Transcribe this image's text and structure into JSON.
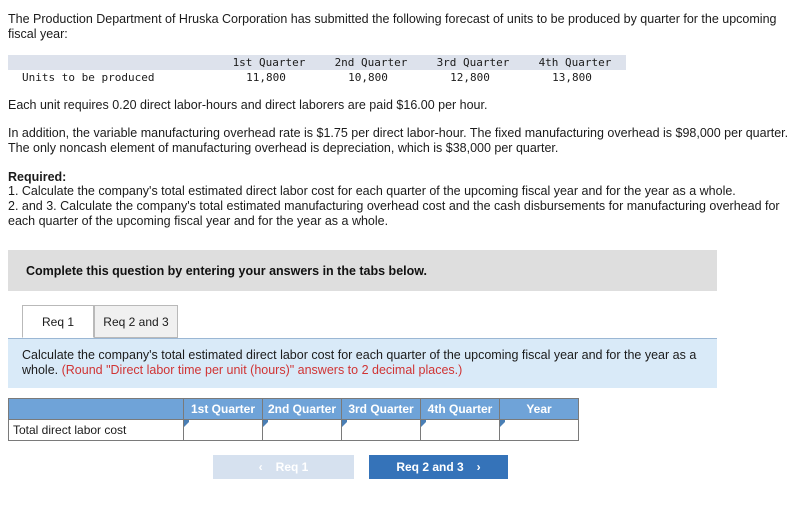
{
  "intro": {
    "paragraph": "The Production Department of Hruska Corporation has submitted the following forecast of units to be produced by quarter for the upcoming fiscal year:"
  },
  "forecast_table": {
    "row_label_header": "",
    "columns": [
      "1st Quarter",
      "2nd Quarter",
      "3rd Quarter",
      "4th Quarter"
    ],
    "rows": [
      {
        "label": "Units to be produced",
        "values": [
          "11,800",
          "10,800",
          "12,800",
          "13,800"
        ]
      }
    ]
  },
  "facts": {
    "labor": "Each unit requires 0.20 direct labor-hours and direct laborers are paid $16.00 per hour.",
    "overhead": "In addition, the variable manufacturing overhead rate is $1.75 per direct labor-hour. The fixed manufacturing overhead is $98,000 per quarter. The only noncash element of manufacturing overhead is depreciation, which is $38,000 per quarter."
  },
  "required": {
    "title": "Required:",
    "item1": "1. Calculate the company's total estimated direct labor cost for each quarter of the upcoming fiscal year and for the year as a whole.",
    "item2": "2. and 3. Calculate the company's total estimated manufacturing overhead cost and the cash disbursements for manufacturing overhead for each quarter of the upcoming fiscal year and for the year as a whole."
  },
  "banner": {
    "text": "Complete this question by entering your answers in the tabs below."
  },
  "tabs": [
    {
      "label": "Req 1",
      "active": true
    },
    {
      "label": "Req 2 and 3",
      "active": false
    }
  ],
  "instruction_panel": {
    "text_main": "Calculate the company's total estimated direct labor cost for each quarter of the upcoming fiscal year and for the year as a whole. ",
    "text_note": "(Round \"Direct labor time per unit (hours)\" answers to 2 decimal places.)"
  },
  "answer_table": {
    "blank_header": "",
    "columns": [
      "1st Quarter",
      "2nd Quarter",
      "3rd Quarter",
      "4th Quarter",
      "Year"
    ],
    "rows": [
      {
        "label": "Total direct labor cost",
        "values": [
          "",
          "",
          "",
          "",
          ""
        ]
      }
    ]
  },
  "nav": {
    "prev_label": "Req 1",
    "prev_icon": "chevron-left-icon",
    "prev_glyph": "‹",
    "next_label": "Req 2 and 3",
    "next_icon": "chevron-right-icon",
    "next_glyph": "›"
  },
  "colors": {
    "banner_gray": "#dedede",
    "panel_blue": "#d9eaf8",
    "table_header_blue": "#6fa3d8",
    "button_blue": "#3573b9",
    "button_disabled": "#d6e1ef",
    "note_red": "#d03434",
    "forecast_header_bg": "#dde2ec"
  }
}
